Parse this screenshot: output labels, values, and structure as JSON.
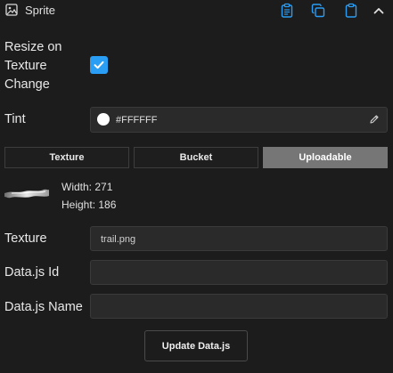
{
  "header": {
    "title": "Sprite",
    "icons": [
      "image-icon",
      "clipboard-list-icon",
      "copy-icon",
      "clipboard-icon",
      "chevron-up-icon"
    ],
    "accent": "#2a9df4"
  },
  "resize": {
    "label_line1": "Resize on",
    "label_line2": "Texture",
    "label_line3": "Change",
    "checked": true
  },
  "tint": {
    "label": "Tint",
    "value": "#FFFFFF",
    "swatch_color": "#FFFFFF"
  },
  "tabs": [
    {
      "label": "Texture",
      "active": false
    },
    {
      "label": "Bucket",
      "active": false
    },
    {
      "label": "Uploadable",
      "active": true
    }
  ],
  "image_info": {
    "width_label": "Width: 271",
    "height_label": "Height: 186"
  },
  "texture": {
    "label": "Texture",
    "value": "trail.png"
  },
  "datajs_id": {
    "label": "Data.js Id",
    "value": ""
  },
  "datajs_name": {
    "label": "Data.js Name",
    "value": ""
  },
  "update_button": {
    "label": "Update Data.js"
  }
}
